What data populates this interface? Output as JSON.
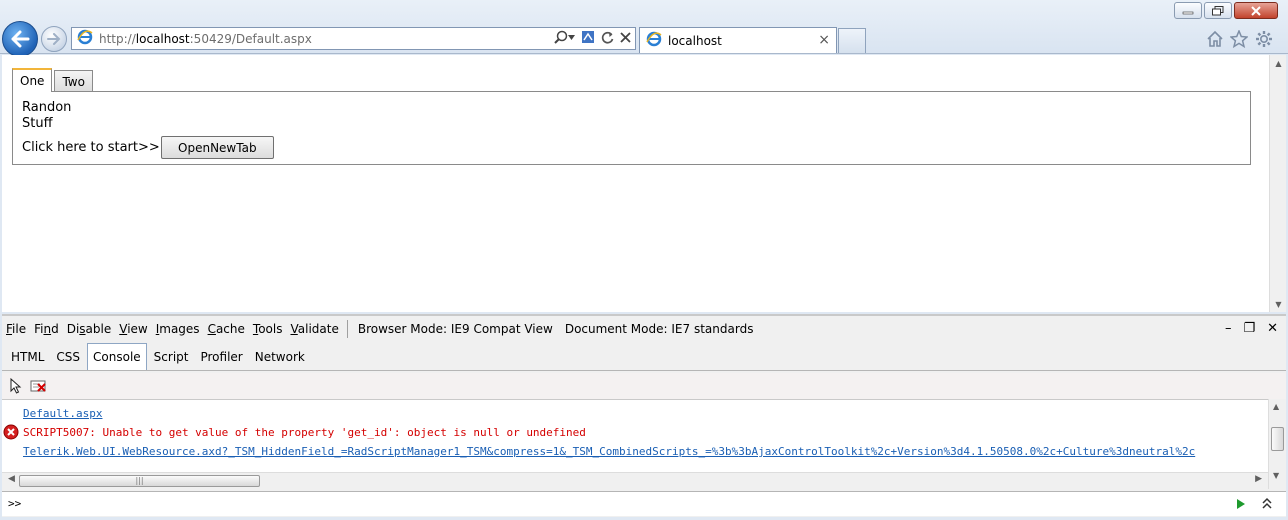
{
  "browser": {
    "address_prefix": "http://",
    "address_host": "localhost",
    "address_rest": ":50429/Default.aspx",
    "tab_title": "localhost"
  },
  "page": {
    "tabs": [
      "One",
      "Two"
    ],
    "content_line1": "Randon",
    "content_line2": "Stuff",
    "start_label": "Click here to start>>",
    "open_button": "OpenNewTab"
  },
  "devtools": {
    "menu": [
      "File",
      "Find",
      "Disable",
      "View",
      "Images",
      "Cache",
      "Tools",
      "Validate"
    ],
    "browser_mode_label": "Browser Mode:",
    "browser_mode_value": "IE9 Compat View",
    "document_mode_label": "Document Mode:",
    "document_mode_value": "IE7 standards",
    "tabs": [
      "HTML",
      "CSS",
      "Console",
      "Script",
      "Profiler",
      "Network"
    ],
    "active_tab": "Console",
    "log": {
      "link1": "Default.aspx",
      "error": "SCRIPT5007: Unable to get value of the property 'get_id': object is null or undefined",
      "link2": "Telerik.Web.UI.WebResource.axd?_TSM_HiddenField_=RadScriptManager1_TSM&compress=1&_TSM_CombinedScripts_=%3b%3bAjaxControlToolkit%2c+Version%3d4.1.50508.0%2c+Culture%3dneutral%2c"
    },
    "prompt": ">>"
  },
  "colors": {
    "accent": "#1f62b6",
    "error": "#d40000",
    "link": "#1a5fb4",
    "tab_highlight": "#f2b53a"
  }
}
